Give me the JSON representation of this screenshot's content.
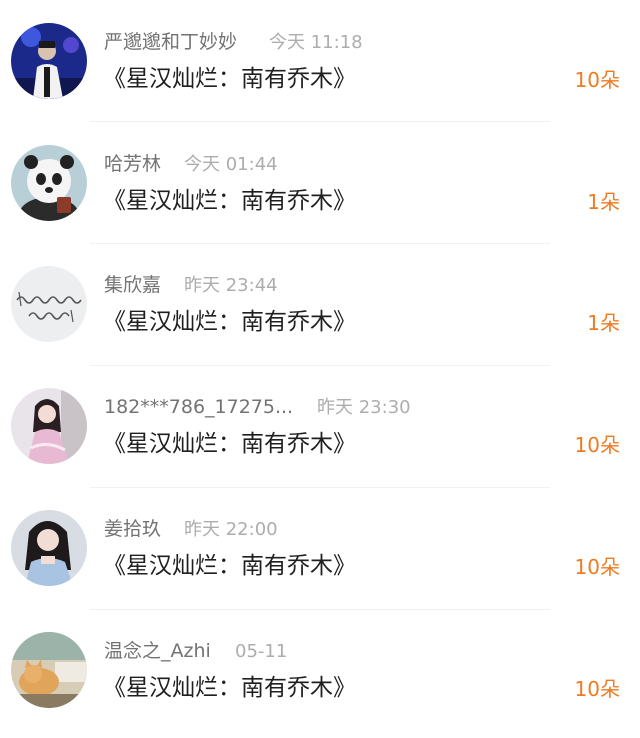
{
  "colors": {
    "accent": "#f07a20",
    "name_text": "#737373",
    "time_text": "#adadad",
    "gift_text": "#1f1f1f"
  },
  "gift_list": {
    "items": [
      {
        "user": "严邈邈和丁妙妙",
        "time": "今天 11:18",
        "gift": "《星汉灿烂：南有乔木》",
        "count": "10朵",
        "avatar": "stage-photo-avatar"
      },
      {
        "user": "哈芳林",
        "time": "今天 01:44",
        "gift": "《星汉灿烂：南有乔木》",
        "count": "1朵",
        "avatar": "panda-avatar"
      },
      {
        "user": "集欣嘉",
        "time": "昨天 23:44",
        "gift": "《星汉灿烂：南有乔木》",
        "count": "1朵",
        "avatar": "handwriting-avatar"
      },
      {
        "user": "182***786_17275...",
        "time": "昨天 23:30",
        "gift": "《星汉灿烂：南有乔木》",
        "count": "10朵",
        "avatar": "costume-girl-avatar"
      },
      {
        "user": "姜拾玖",
        "time": "昨天 22:00",
        "gift": "《星汉灿烂：南有乔木》",
        "count": "10朵",
        "avatar": "portrait-girl-avatar"
      },
      {
        "user": "温念之_Azhi",
        "time": "05-11",
        "gift": "《星汉灿烂：南有乔木》",
        "count": "10朵",
        "avatar": "cat-avatar"
      }
    ]
  }
}
